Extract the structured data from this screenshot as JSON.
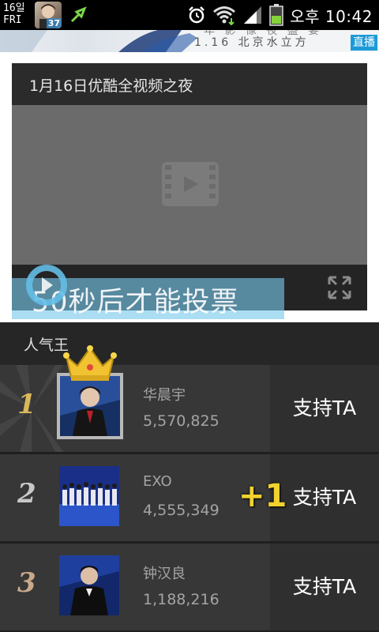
{
  "status_bar": {
    "date_day": "16일",
    "date_weekday": "FRI",
    "avatar_badge": "37",
    "time": "오후 10:42"
  },
  "banner": {
    "text_top": "年 影 像    夜 盛 宴",
    "text": "1.16  北京水立方",
    "live_label": "直播"
  },
  "video": {
    "title": "1月16日优酷全视频之夜",
    "vote_overlay_text": "50秒后才能投票"
  },
  "popularity": {
    "section_title": "人气王",
    "rows": [
      {
        "rank": "1",
        "name": "华晨宇",
        "votes": "5,570,825",
        "support_label": "支持TA"
      },
      {
        "rank": "2",
        "name": "EXO",
        "votes": "4,555,349",
        "support_label": "支持TA",
        "plus_badge": "+1"
      },
      {
        "rank": "3",
        "name": "钟汉良",
        "votes": "1,188,216",
        "support_label": "支持TA"
      }
    ]
  },
  "colors": {
    "accent_blue": "#1d9ad6",
    "gold": "#d9b85a",
    "plus_yellow": "#f2d22e"
  }
}
